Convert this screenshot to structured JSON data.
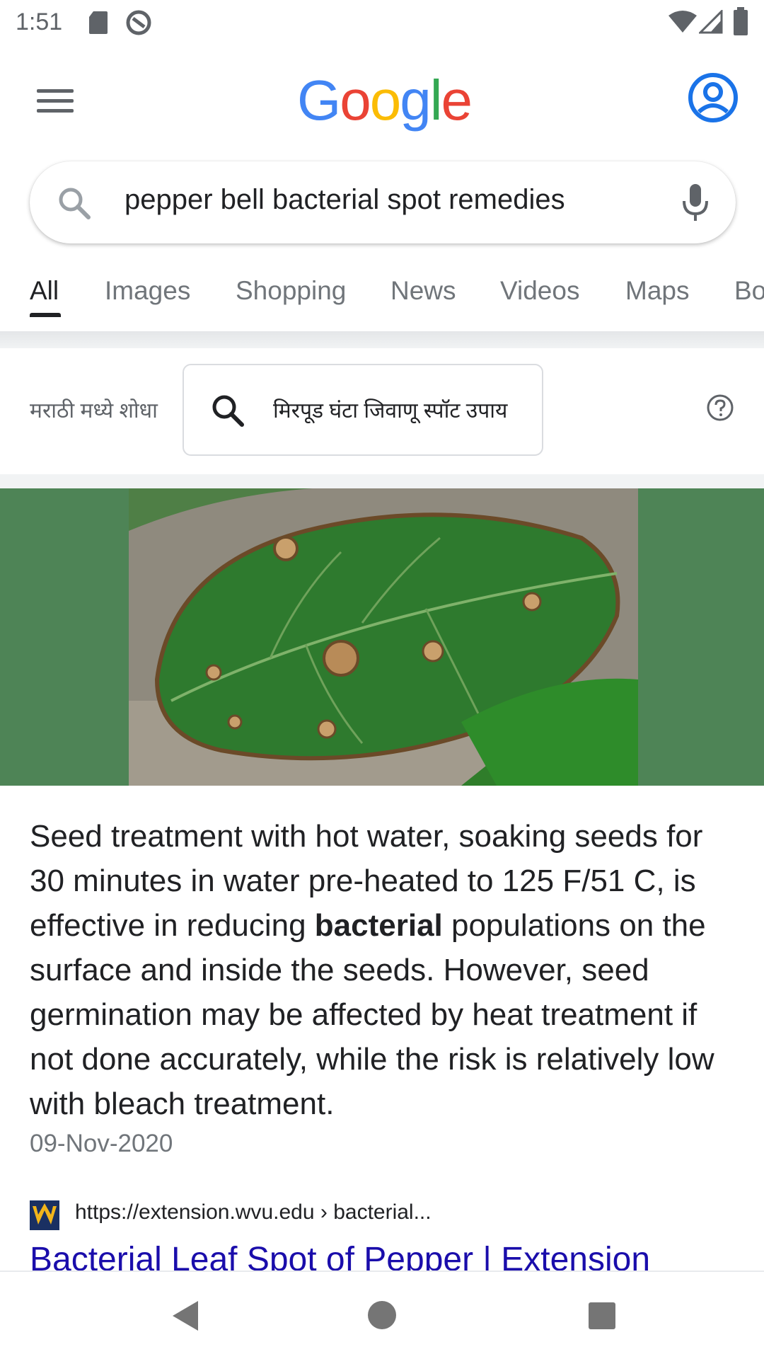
{
  "status_bar": {
    "time": "1:51"
  },
  "header": {
    "logo": [
      "G",
      "o",
      "o",
      "g",
      "l",
      "e"
    ],
    "logo_colors": [
      "#4285F4",
      "#EA4335",
      "#FBBC05",
      "#4285F4",
      "#34A853",
      "#EA4335"
    ]
  },
  "search": {
    "query": "pepper bell bacterial spot remedies"
  },
  "tabs": [
    {
      "label": "All"
    },
    {
      "label": "Images"
    },
    {
      "label": "Shopping"
    },
    {
      "label": "News"
    },
    {
      "label": "Videos"
    },
    {
      "label": "Maps"
    },
    {
      "label": "Bo"
    }
  ],
  "translate": {
    "label": "मराठी मध्ये शोधा",
    "query": "मिरपूड घंटा जिवाणू स्पॉट उपाय"
  },
  "snippet": {
    "text_before": "Seed treatment with hot water, soaking seeds for 30 minutes in water pre-heated to 125 F/51 C, is effective in reducing ",
    "bold": "bacterial",
    "text_after": " populations on the surface and inside the seeds. However, seed germination may be affected by heat treatment if not done accurately, while the risk is relatively low with bleach treatment.",
    "date": "09-Nov-2020"
  },
  "result": {
    "url": "https://extension.wvu.edu › bacterial...",
    "title": "Bacterial Leaf Spot of Pepper | Extension"
  },
  "colors": {
    "accent_blue": "#1a73e8",
    "link": "#1a0dab",
    "image_bg": "#4e8456"
  }
}
